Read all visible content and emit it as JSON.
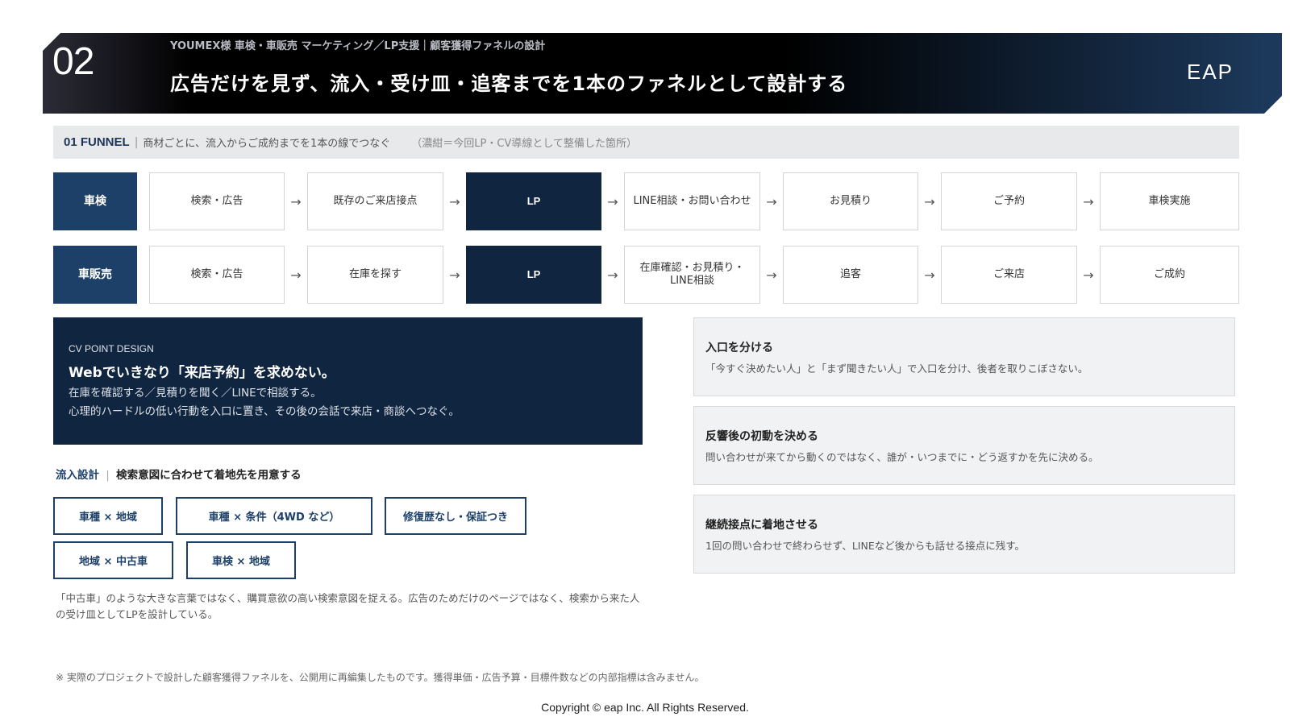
{
  "header": {
    "number": "02",
    "subtitle": "YOUMEX様 車検・車販売 マーケティング／LP支援｜顧客獲得ファネルの設計",
    "title": "広告だけを見ず、流入・受け皿・追客までを1本のファネルとして設計する",
    "logo_text": "EAP"
  },
  "funnel": {
    "label": "01  FUNNEL",
    "separator": "|",
    "description": "商材ごとに、流入からご成約までを1本の線でつなぐ",
    "note": "（濃紺＝今回LP・CV導線として整備した箇所）",
    "arrow": "→",
    "rows": [
      {
        "category": "車検",
        "steps": [
          "検索・広告",
          "既存のご来店接点",
          "LP",
          "LINE相談・お問い合わせ",
          "お見積り",
          "ご予約",
          "車検実施"
        ]
      },
      {
        "category": "車販売",
        "steps": [
          "検索・広告",
          "在庫を探す",
          "LP",
          "在庫確認・お見積り・LINE相談",
          "追客",
          "ご来店",
          "ご成約"
        ]
      }
    ]
  },
  "cv": {
    "label": "CV POINT DESIGN",
    "title": "Webでいきなり「来店予約」を求めない。",
    "line1": "在庫を確認する／見積りを聞く／LINEで相談する。",
    "line2": "心理的ハードルの低い行動を入口に置き、その後の会話で来店・商談へつなぐ。"
  },
  "inflow": {
    "label": "流入設計",
    "separator": "|",
    "text": "検索意図に合わせて着地先を用意する",
    "keywords": [
      "車種 × 地域",
      "車種 × 条件（4WD など）",
      "修復歴なし・保証つき",
      "地域 × 中古車",
      "車検 × 地域"
    ],
    "description": "「中古車」のような大きな言葉ではなく、購買意欲の高い検索意図を捉える。広告のためだけのページではなく、検索から来た人の受け皿としてLPを設計している。"
  },
  "cards": [
    {
      "title": "入口を分ける",
      "text": "「今すぐ決めたい人」と「まず聞きたい人」で入口を分け、後者を取りこぼさない。"
    },
    {
      "title": "反響後の初動を決める",
      "text": "問い合わせが来てから動くのではなく、誰が・いつまでに・どう返すかを先に決める。"
    },
    {
      "title": "継続接点に着地させる",
      "text": "1回の問い合わせで終わらせず、LINEなど後からも話せる接点に残す。"
    }
  ],
  "footnote": "※ 実際のプロジェクトで設計した顧客獲得ファネルを、公開用に再編集したものです。獲得単価・広告予算・目標件数などの内部指標は含みません。",
  "copyright": "Copyright © eap Inc. All Rights Reserved."
}
